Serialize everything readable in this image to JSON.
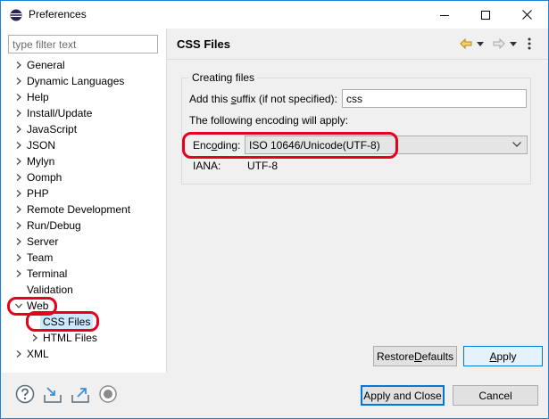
{
  "window": {
    "title": "Preferences",
    "icon": "eclipse-icon",
    "controls": [
      "minimize-icon",
      "maximize-icon",
      "close-icon"
    ]
  },
  "filter": {
    "placeholder": "type filter text",
    "value": ""
  },
  "tree": {
    "items": [
      {
        "label": "General",
        "expanded": false
      },
      {
        "label": "Dynamic Languages",
        "expanded": false
      },
      {
        "label": "Help",
        "expanded": false
      },
      {
        "label": "Install/Update",
        "expanded": false
      },
      {
        "label": "JavaScript",
        "expanded": false
      },
      {
        "label": "JSON",
        "expanded": false
      },
      {
        "label": "Mylyn",
        "expanded": false
      },
      {
        "label": "Oomph",
        "expanded": false
      },
      {
        "label": "PHP",
        "expanded": false
      },
      {
        "label": "Remote Development",
        "expanded": false
      },
      {
        "label": "Run/Debug",
        "expanded": false
      },
      {
        "label": "Server",
        "expanded": false
      },
      {
        "label": "Team",
        "expanded": false
      },
      {
        "label": "Terminal",
        "expanded": false
      },
      {
        "label": "Validation",
        "expanded": null
      },
      {
        "label": "Web",
        "expanded": true
      },
      {
        "label": "CSS Files",
        "expanded": null,
        "selected": true
      },
      {
        "label": "HTML Files",
        "expanded": false
      },
      {
        "label": "XML",
        "expanded": false
      }
    ]
  },
  "page": {
    "title": "CSS Files",
    "nav_icons": [
      "back-arrow-icon",
      "back-menu-icon",
      "forward-arrow-icon",
      "forward-menu-icon",
      "view-menu-icon"
    ],
    "group_title": "Creating files",
    "suffix_label_pre": "Add this ",
    "suffix_label_accel": "s",
    "suffix_label_post": "uffix (if not specified):",
    "suffix_value": "css",
    "encoding_note": "The following encoding will apply:",
    "encoding_label_pre": "Enc",
    "encoding_label_accel": "o",
    "encoding_label_post": "ding:",
    "encoding_value": "ISO 10646/Unicode(UTF-8)",
    "iana_label": "IANA:",
    "iana_value": "UTF-8"
  },
  "buttons": {
    "restore_pre": "Restore ",
    "restore_accel": "D",
    "restore_post": "efaults",
    "apply_accel": "A",
    "apply_post": "pply",
    "apply_and_close": "Apply and Close",
    "cancel": "Cancel"
  },
  "bottom_icons": [
    "help-icon",
    "import-icon",
    "export-icon",
    "record-icon"
  ],
  "colors": {
    "accent": "#0078d7",
    "highlight_annotation": "#e5001c",
    "selection": "#cce8ff"
  }
}
